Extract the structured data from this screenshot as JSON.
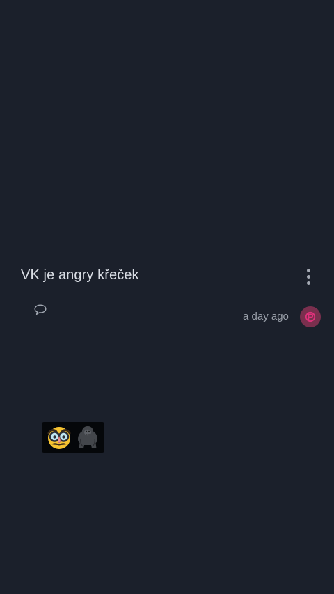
{
  "post": {
    "title": "VK je angry křeček",
    "timestamp": "a day ago"
  },
  "icons": {
    "more": "more-vertical-icon",
    "comment": "comment-bubble-icon",
    "avatar": "user-avatar",
    "sticker": [
      "disguised-face-emoji",
      "gorilla-emoji"
    ]
  },
  "colors": {
    "background": "#1b202b",
    "title_text": "#d9dde4",
    "meta_text": "#9ba1ab",
    "avatar_bg": "#7a2f4e",
    "avatar_accent": "#e0327c"
  }
}
